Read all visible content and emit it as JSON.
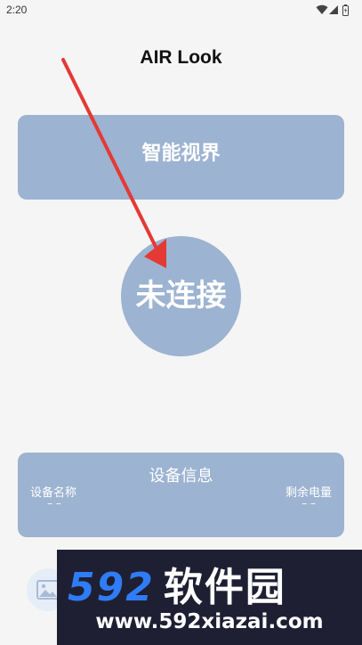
{
  "status_bar": {
    "time": "2:20",
    "icons": [
      "wifi-icon",
      "signal-icon",
      "battery-icon"
    ]
  },
  "header": {
    "title": "AIR Look"
  },
  "vision_card": {
    "label": "智能视界"
  },
  "connect_button": {
    "label": "未连接"
  },
  "device_info": {
    "title": "设备信息",
    "name_label": "设备名称",
    "name_value": "– –",
    "battery_label": "剩余电量",
    "battery_value": "– –"
  },
  "bottom": {
    "gallery_icon": "image-icon"
  },
  "watermark": {
    "brand_number": "592",
    "brand_text": "软件园",
    "url": "www.592xiazai.com"
  },
  "colors": {
    "accent": "#9cb3d1",
    "background": "#f5f5f5",
    "arrow": "#e53935",
    "watermark_bg": "#1f1f33",
    "watermark_blue": "#2f7cf6"
  }
}
